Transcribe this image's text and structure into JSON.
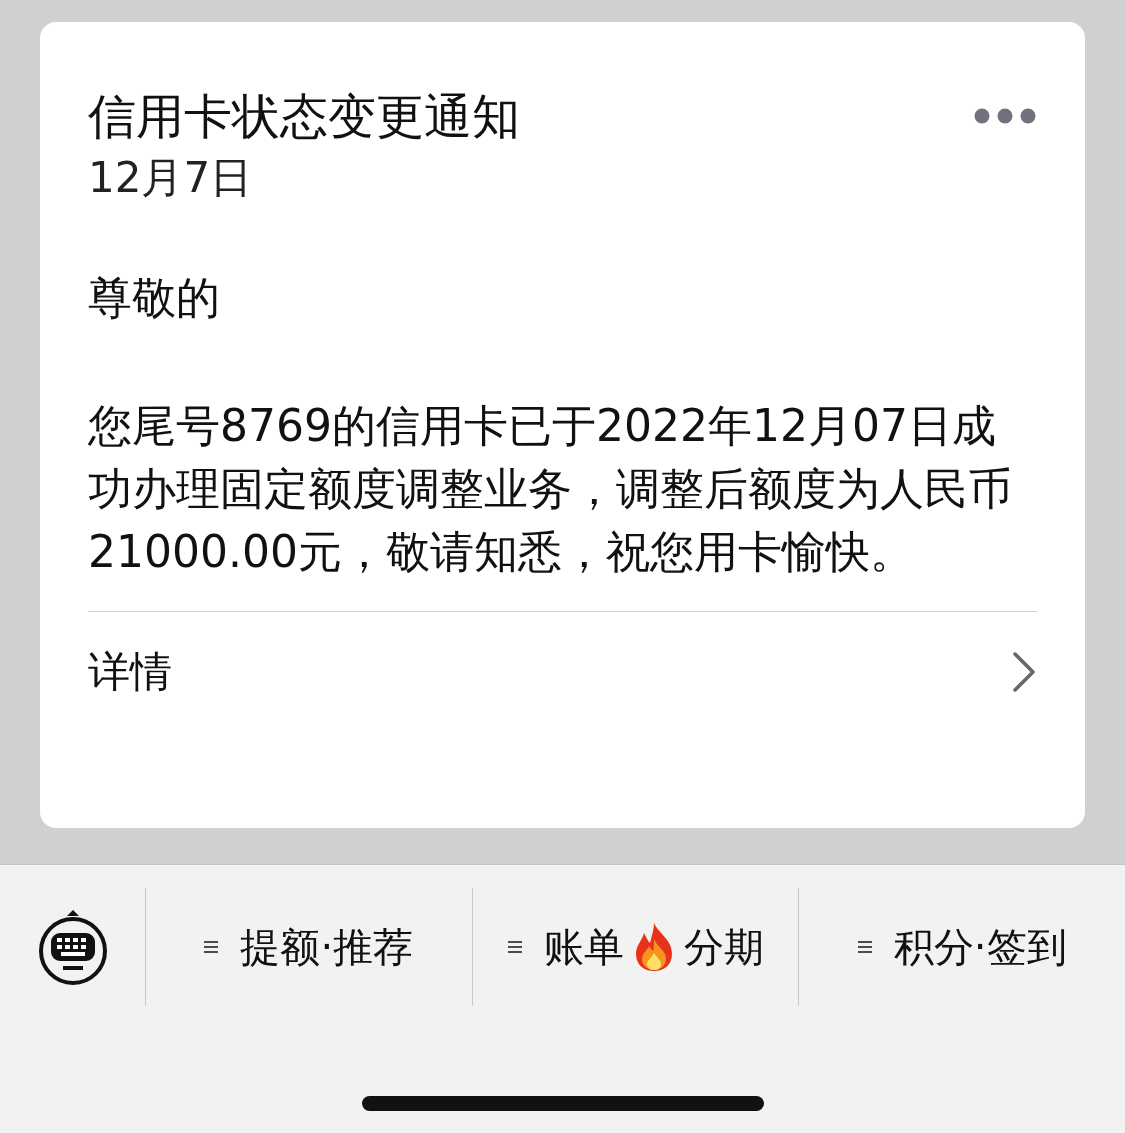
{
  "card": {
    "title": "信用卡状态变更通知",
    "date": "12月7日",
    "greeting": "尊敬的",
    "body": "您尾号8769的信用卡已于2022年12月07日成功办理固定额度调整业务，调整后额度为人民币21000.00元，敬请知悉，祝您用卡愉快。",
    "details": "详情"
  },
  "menu": [
    {
      "kind": "text",
      "label": "提额·推荐"
    },
    {
      "kind": "flame",
      "label": "账单",
      "label_2": "分期"
    },
    {
      "kind": "text",
      "label": "积分·签到"
    }
  ]
}
